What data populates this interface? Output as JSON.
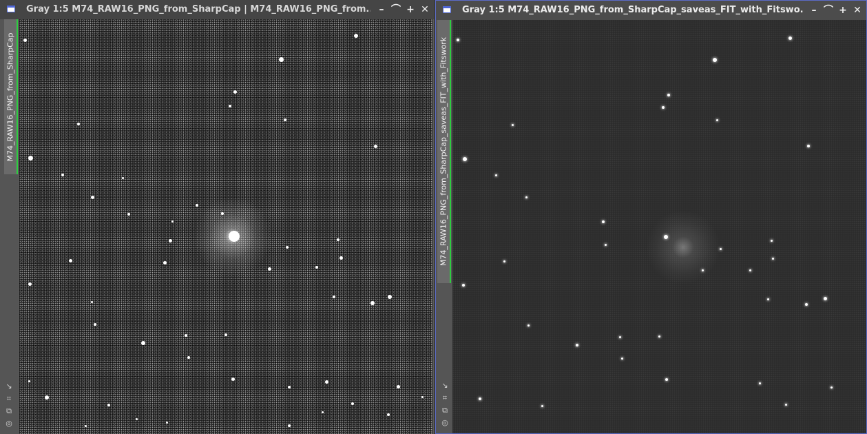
{
  "windows": [
    {
      "title": "Gray 1:5 M74_RAW16_PNG_from_SharpCap | M74_RAW16_PNG_from...",
      "side_tab": "M74_RAW16_PNG_from_SharpCap",
      "controls": {
        "minimize": "–",
        "shade": "⌒",
        "maximize": "+",
        "close": "✕"
      }
    },
    {
      "title": "Gray 1:5 M74_RAW16_PNG_from_SharpCap_saveas_FIT_with_Fitswo...",
      "side_tab": "M74_RAW16_PNG_from_SharpCap_saveas_FIT_with_Fitswork",
      "controls": {
        "minimize": "–",
        "shade": "⌒",
        "maximize": "+",
        "close": "✕"
      }
    }
  ],
  "side_tool_icons": [
    "arrow-down-right-icon",
    "fit-view-icon",
    "clone-view-icon",
    "target-icon"
  ],
  "colors": {
    "active_border": "#5b6bc8",
    "tab_accent": "#2ecc40"
  }
}
